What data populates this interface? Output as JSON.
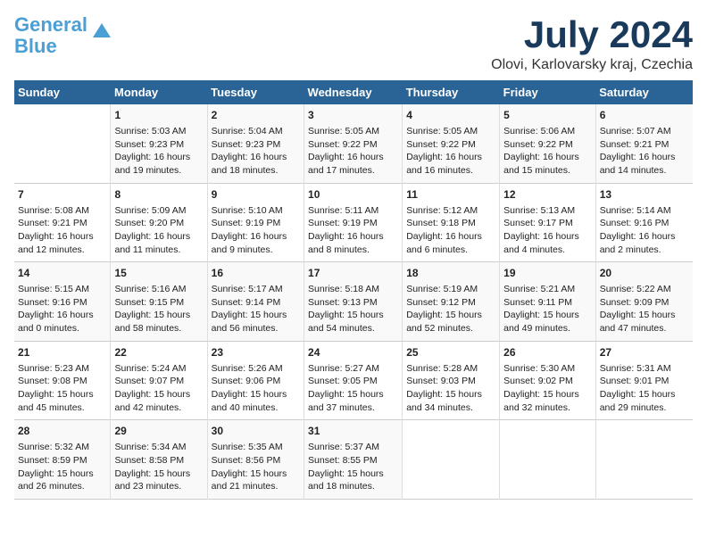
{
  "header": {
    "logo_general": "General",
    "logo_blue": "Blue",
    "month_title": "July 2024",
    "subtitle": "Olovi, Karlovarsky kraj, Czechia"
  },
  "days_of_week": [
    "Sunday",
    "Monday",
    "Tuesday",
    "Wednesday",
    "Thursday",
    "Friday",
    "Saturday"
  ],
  "weeks": [
    [
      {
        "day": "",
        "info": ""
      },
      {
        "day": "1",
        "info": "Sunrise: 5:03 AM\nSunset: 9:23 PM\nDaylight: 16 hours\nand 19 minutes."
      },
      {
        "day": "2",
        "info": "Sunrise: 5:04 AM\nSunset: 9:23 PM\nDaylight: 16 hours\nand 18 minutes."
      },
      {
        "day": "3",
        "info": "Sunrise: 5:05 AM\nSunset: 9:22 PM\nDaylight: 16 hours\nand 17 minutes."
      },
      {
        "day": "4",
        "info": "Sunrise: 5:05 AM\nSunset: 9:22 PM\nDaylight: 16 hours\nand 16 minutes."
      },
      {
        "day": "5",
        "info": "Sunrise: 5:06 AM\nSunset: 9:22 PM\nDaylight: 16 hours\nand 15 minutes."
      },
      {
        "day": "6",
        "info": "Sunrise: 5:07 AM\nSunset: 9:21 PM\nDaylight: 16 hours\nand 14 minutes."
      }
    ],
    [
      {
        "day": "7",
        "info": "Sunrise: 5:08 AM\nSunset: 9:21 PM\nDaylight: 16 hours\nand 12 minutes."
      },
      {
        "day": "8",
        "info": "Sunrise: 5:09 AM\nSunset: 9:20 PM\nDaylight: 16 hours\nand 11 minutes."
      },
      {
        "day": "9",
        "info": "Sunrise: 5:10 AM\nSunset: 9:19 PM\nDaylight: 16 hours\nand 9 minutes."
      },
      {
        "day": "10",
        "info": "Sunrise: 5:11 AM\nSunset: 9:19 PM\nDaylight: 16 hours\nand 8 minutes."
      },
      {
        "day": "11",
        "info": "Sunrise: 5:12 AM\nSunset: 9:18 PM\nDaylight: 16 hours\nand 6 minutes."
      },
      {
        "day": "12",
        "info": "Sunrise: 5:13 AM\nSunset: 9:17 PM\nDaylight: 16 hours\nand 4 minutes."
      },
      {
        "day": "13",
        "info": "Sunrise: 5:14 AM\nSunset: 9:16 PM\nDaylight: 16 hours\nand 2 minutes."
      }
    ],
    [
      {
        "day": "14",
        "info": "Sunrise: 5:15 AM\nSunset: 9:16 PM\nDaylight: 16 hours\nand 0 minutes."
      },
      {
        "day": "15",
        "info": "Sunrise: 5:16 AM\nSunset: 9:15 PM\nDaylight: 15 hours\nand 58 minutes."
      },
      {
        "day": "16",
        "info": "Sunrise: 5:17 AM\nSunset: 9:14 PM\nDaylight: 15 hours\nand 56 minutes."
      },
      {
        "day": "17",
        "info": "Sunrise: 5:18 AM\nSunset: 9:13 PM\nDaylight: 15 hours\nand 54 minutes."
      },
      {
        "day": "18",
        "info": "Sunrise: 5:19 AM\nSunset: 9:12 PM\nDaylight: 15 hours\nand 52 minutes."
      },
      {
        "day": "19",
        "info": "Sunrise: 5:21 AM\nSunset: 9:11 PM\nDaylight: 15 hours\nand 49 minutes."
      },
      {
        "day": "20",
        "info": "Sunrise: 5:22 AM\nSunset: 9:09 PM\nDaylight: 15 hours\nand 47 minutes."
      }
    ],
    [
      {
        "day": "21",
        "info": "Sunrise: 5:23 AM\nSunset: 9:08 PM\nDaylight: 15 hours\nand 45 minutes."
      },
      {
        "day": "22",
        "info": "Sunrise: 5:24 AM\nSunset: 9:07 PM\nDaylight: 15 hours\nand 42 minutes."
      },
      {
        "day": "23",
        "info": "Sunrise: 5:26 AM\nSunset: 9:06 PM\nDaylight: 15 hours\nand 40 minutes."
      },
      {
        "day": "24",
        "info": "Sunrise: 5:27 AM\nSunset: 9:05 PM\nDaylight: 15 hours\nand 37 minutes."
      },
      {
        "day": "25",
        "info": "Sunrise: 5:28 AM\nSunset: 9:03 PM\nDaylight: 15 hours\nand 34 minutes."
      },
      {
        "day": "26",
        "info": "Sunrise: 5:30 AM\nSunset: 9:02 PM\nDaylight: 15 hours\nand 32 minutes."
      },
      {
        "day": "27",
        "info": "Sunrise: 5:31 AM\nSunset: 9:01 PM\nDaylight: 15 hours\nand 29 minutes."
      }
    ],
    [
      {
        "day": "28",
        "info": "Sunrise: 5:32 AM\nSunset: 8:59 PM\nDaylight: 15 hours\nand 26 minutes."
      },
      {
        "day": "29",
        "info": "Sunrise: 5:34 AM\nSunset: 8:58 PM\nDaylight: 15 hours\nand 23 minutes."
      },
      {
        "day": "30",
        "info": "Sunrise: 5:35 AM\nSunset: 8:56 PM\nDaylight: 15 hours\nand 21 minutes."
      },
      {
        "day": "31",
        "info": "Sunrise: 5:37 AM\nSunset: 8:55 PM\nDaylight: 15 hours\nand 18 minutes."
      },
      {
        "day": "",
        "info": ""
      },
      {
        "day": "",
        "info": ""
      },
      {
        "day": "",
        "info": ""
      }
    ]
  ]
}
